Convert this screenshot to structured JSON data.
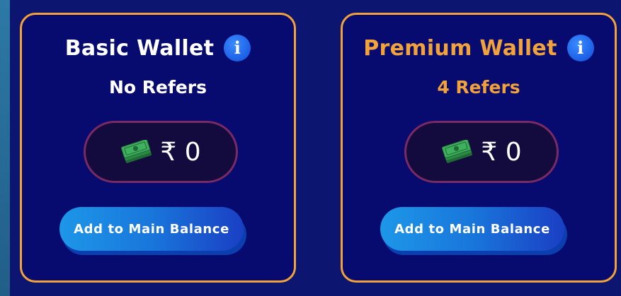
{
  "cards": [
    {
      "title": "Basic Wallet",
      "refers": "No Refers",
      "amount": "₹ 0",
      "button_label": "Add to Main Balance",
      "info_label": "i"
    },
    {
      "title": "Premium Wallet",
      "refers": "4 Refers",
      "amount": "₹ 0",
      "button_label": "Add to Main Balance",
      "info_label": "i"
    }
  ],
  "colors": {
    "background": "#0c1670",
    "card_bg": "#070a6e",
    "card_border": "#f2a23a",
    "basic_text": "#ffffff",
    "premium_text": "#f2a23a",
    "button": "#1976db",
    "info": "#1c5fe6"
  },
  "icons": {
    "info": "info-icon",
    "cash": "cash-icon"
  }
}
